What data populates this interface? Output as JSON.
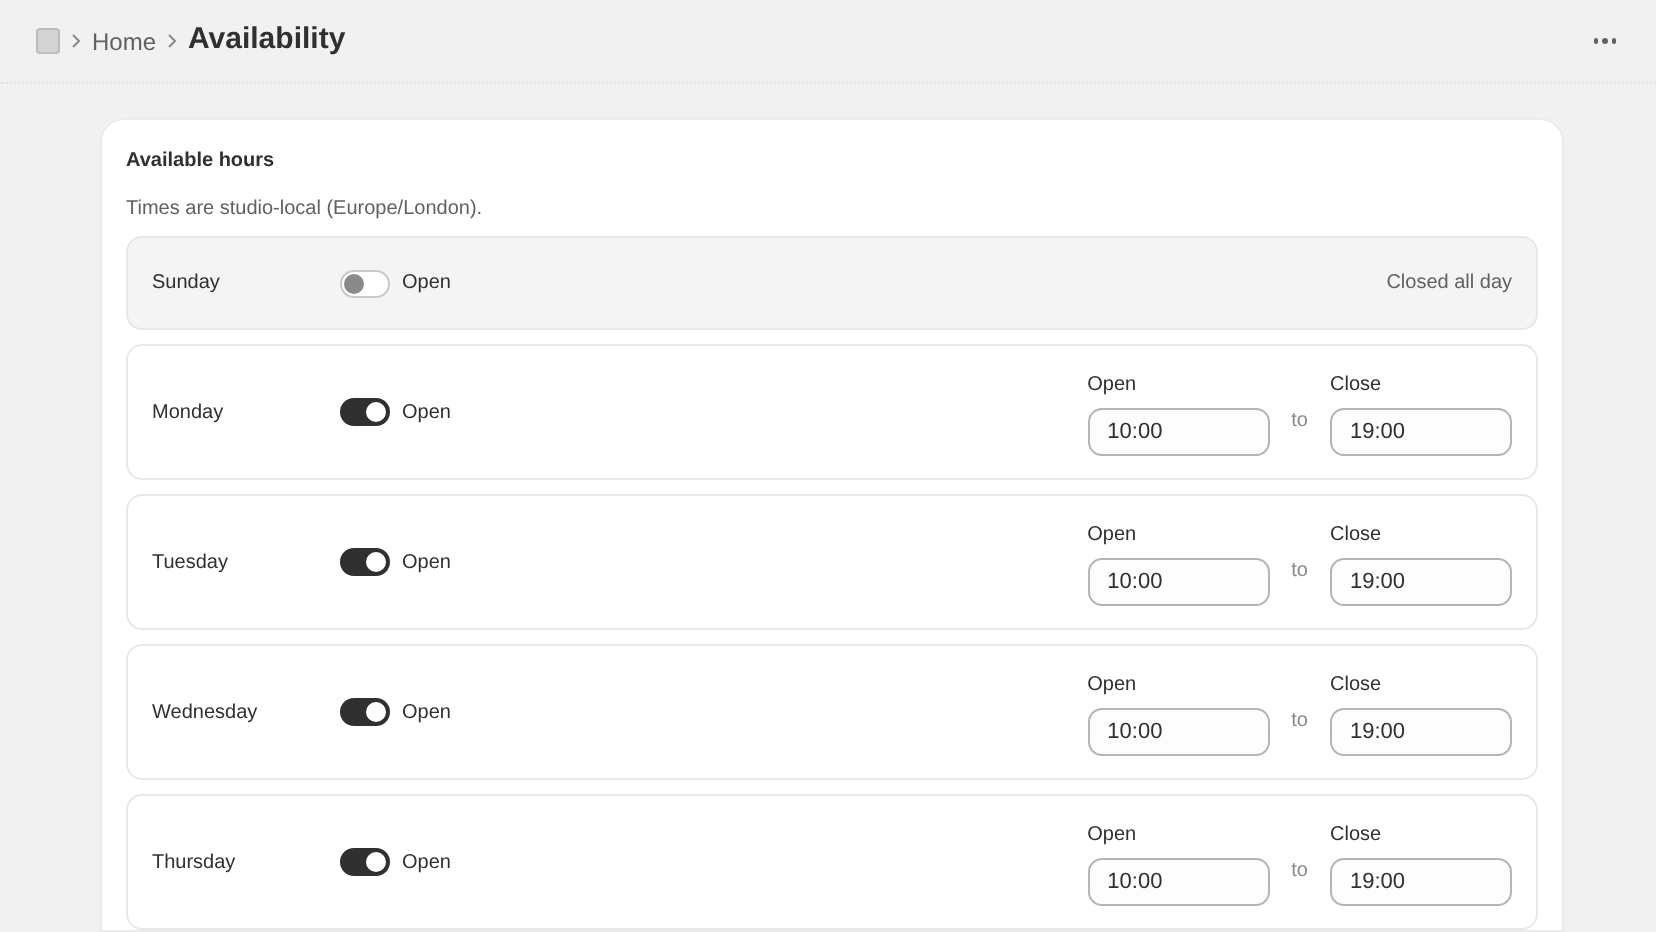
{
  "breadcrumb": {
    "items": [
      "Home"
    ],
    "current": "Availability"
  },
  "card": {
    "title": "Available hours",
    "note": "Times are studio-local (Europe/London).",
    "days": [
      {
        "name": "Sunday",
        "on": false,
        "toggle_label": "Open",
        "closed_text": "Closed all day"
      },
      {
        "name": "Monday",
        "on": true,
        "toggle_label": "Open",
        "open_label": "Open",
        "open": "10:00",
        "to": "to",
        "close_label": "Close",
        "close": "19:00"
      },
      {
        "name": "Tuesday",
        "on": true,
        "toggle_label": "Open",
        "open_label": "Open",
        "open": "10:00",
        "to": "to",
        "close_label": "Close",
        "close": "19:00"
      },
      {
        "name": "Wednesday",
        "on": true,
        "toggle_label": "Open",
        "open_label": "Open",
        "open": "10:00",
        "to": "to",
        "close_label": "Close",
        "close": "19:00"
      },
      {
        "name": "Thursday",
        "on": true,
        "toggle_label": "Open",
        "open_label": "Open",
        "open": "10:00",
        "to": "to",
        "close_label": "Close",
        "close": "19:00"
      }
    ]
  }
}
